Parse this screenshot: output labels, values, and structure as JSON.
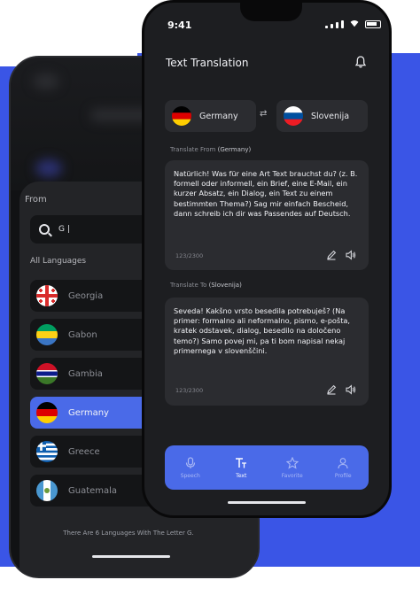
{
  "back_screen": {
    "from_label": "From",
    "search": {
      "value": "G |"
    },
    "all_languages_label": "All Languages",
    "languages": [
      {
        "name": "Georgia",
        "icon": "georgia-flag-icon",
        "active": false
      },
      {
        "name": "Gabon",
        "icon": "gabon-flag-icon",
        "active": false
      },
      {
        "name": "Gambia",
        "icon": "gambia-flag-icon",
        "active": false
      },
      {
        "name": "Germany",
        "icon": "germany-flag-icon",
        "active": true
      },
      {
        "name": "Greece",
        "icon": "greece-flag-icon",
        "active": false
      },
      {
        "name": "Guatemala",
        "icon": "guatemala-flag-icon",
        "active": false
      }
    ],
    "footer_text": "There Are 6 Languages With The Letter G."
  },
  "front_screen": {
    "status": {
      "time": "9:41"
    },
    "header": {
      "title": "Text Translation",
      "bell_icon": "bell-icon"
    },
    "source_language": "Germany",
    "target_language": "Slovenija",
    "swap_icon": "⇄",
    "translate_from": {
      "label_prefix": "Translate From",
      "label_lang": "(Germany)",
      "text": "Natürlich! Was für eine Art Text brauchst du? (z. B. formell oder informell, ein Brief, eine E-Mail, ein kurzer Absatz, ein Dialog, ein Text zu einem bestimmten Thema?) Sag mir einfach Bescheid, dann schreib ich dir was Passendes auf Deutsch.",
      "count": "123/2300"
    },
    "translate_to": {
      "label_prefix": "Translate To",
      "label_lang": "(Slovenija)",
      "text": "Seveda! Kakšno vrsto besedila potrebuješ? (Na primer: formalno ali neformalno, pismo, e-pošta, kratek odstavek, dialog, besedilo na določeno temo?) Samo povej mi, pa ti bom napisal nekaj primernega v slovenščini.",
      "count": "123/2300"
    },
    "nav": [
      {
        "label": "Speech",
        "icon": "mic-icon",
        "active": false
      },
      {
        "label": "Text",
        "icon": "text-icon",
        "active": true
      },
      {
        "label": "Favorite",
        "icon": "star-icon",
        "active": false
      },
      {
        "label": "Profile",
        "icon": "user-icon",
        "active": false
      }
    ]
  },
  "colors": {
    "accent": "#4a6ae8",
    "backdrop": "#3a55e6",
    "card": "#2b2c30"
  }
}
